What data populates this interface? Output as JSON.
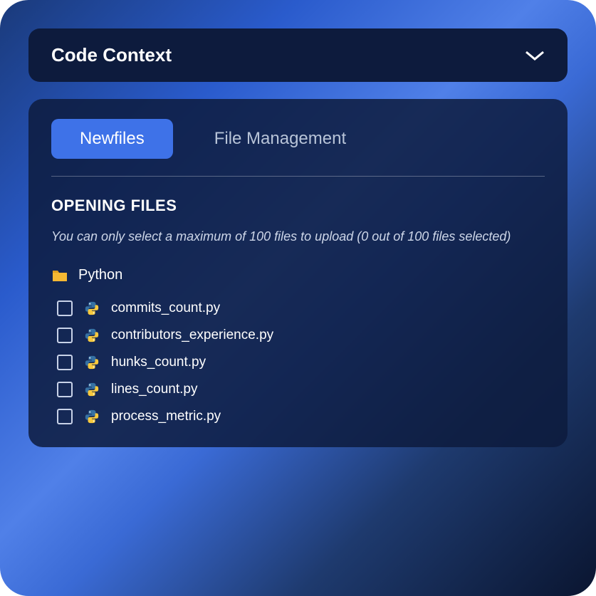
{
  "header": {
    "title": "Code Context"
  },
  "tabs": {
    "active": "Newfiles",
    "inactive": "File Management"
  },
  "section": {
    "title": "OPENING FILES",
    "hint": "You can only select a maximum of 100 files to upload (0 out of 100 files selected)"
  },
  "folder": {
    "name": "Python"
  },
  "files": [
    {
      "name": "commits_count.py"
    },
    {
      "name": "contributors_experience.py"
    },
    {
      "name": "hunks_count.py"
    },
    {
      "name": "lines_count.py"
    },
    {
      "name": "process_metric.py"
    }
  ]
}
